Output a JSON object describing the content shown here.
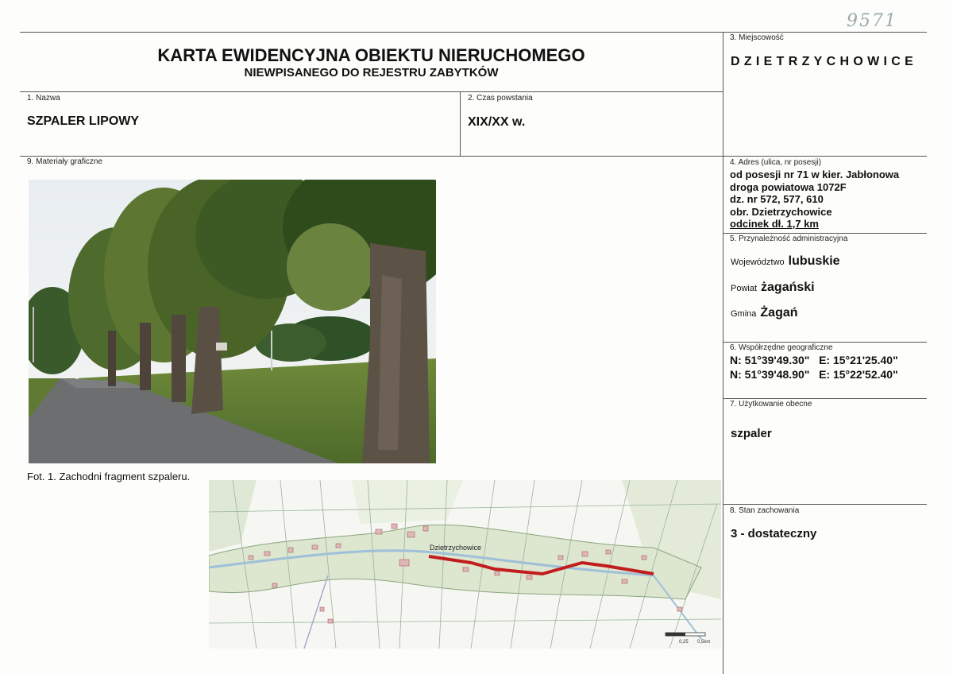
{
  "handwritten_number": "9571",
  "header": {
    "title": "KARTA EWIDENCYJNA OBIEKTU NIERUCHOMEGO",
    "subtitle": "NIEWPISANEGO DO REJESTRU ZABYTKÓW"
  },
  "fields": {
    "miejscowosc": {
      "label": "3. Miejscowość",
      "value": "DZIETRZYCHOWICE"
    },
    "nazwa": {
      "label": "1. Nazwa",
      "value": "SZPALER LIPOWY"
    },
    "czas": {
      "label": "2. Czas powstania",
      "value": "XIX/XX w."
    },
    "materialy": {
      "label": "9. Materiały graficzne"
    },
    "adres": {
      "label": "4. Adres (ulica, nr posesji)",
      "lines": [
        "od posesji nr 71 w kier. Jabłonowa",
        "droga powiatowa 1072F",
        "dz. nr 572, 577, 610",
        "obr. Dzietrzychowice",
        "odcinek dł. 1,7 km"
      ]
    },
    "przynaleznosc": {
      "label": "5. Przynależność administracyjna",
      "rows": [
        {
          "key": "Województwo",
          "value": "lubuskie"
        },
        {
          "key": "Powiat",
          "value": "żagański"
        },
        {
          "key": "Gmina",
          "value": "Żagań"
        }
      ]
    },
    "wspolrzedne": {
      "label": "6. Współrzędne geograficzne",
      "rows": [
        "N: 51°39'49.30\"   E: 15°21'25.40\"",
        "N: 51°39'48.90\"   E: 15°22'52.40\""
      ]
    },
    "uzytkowanie": {
      "label": "7. Użytkowanie obecne",
      "value": "szpaler"
    },
    "stan": {
      "label": "8. Stan zachowania",
      "value": "3 - dostateczny"
    }
  },
  "photo": {
    "caption": "Fot. 1. Zachodni fragment szpaleru."
  },
  "map": {
    "place_label": "Dzietrzychowice",
    "scale_label": "0,25",
    "scale_unit": "0,5km"
  }
}
